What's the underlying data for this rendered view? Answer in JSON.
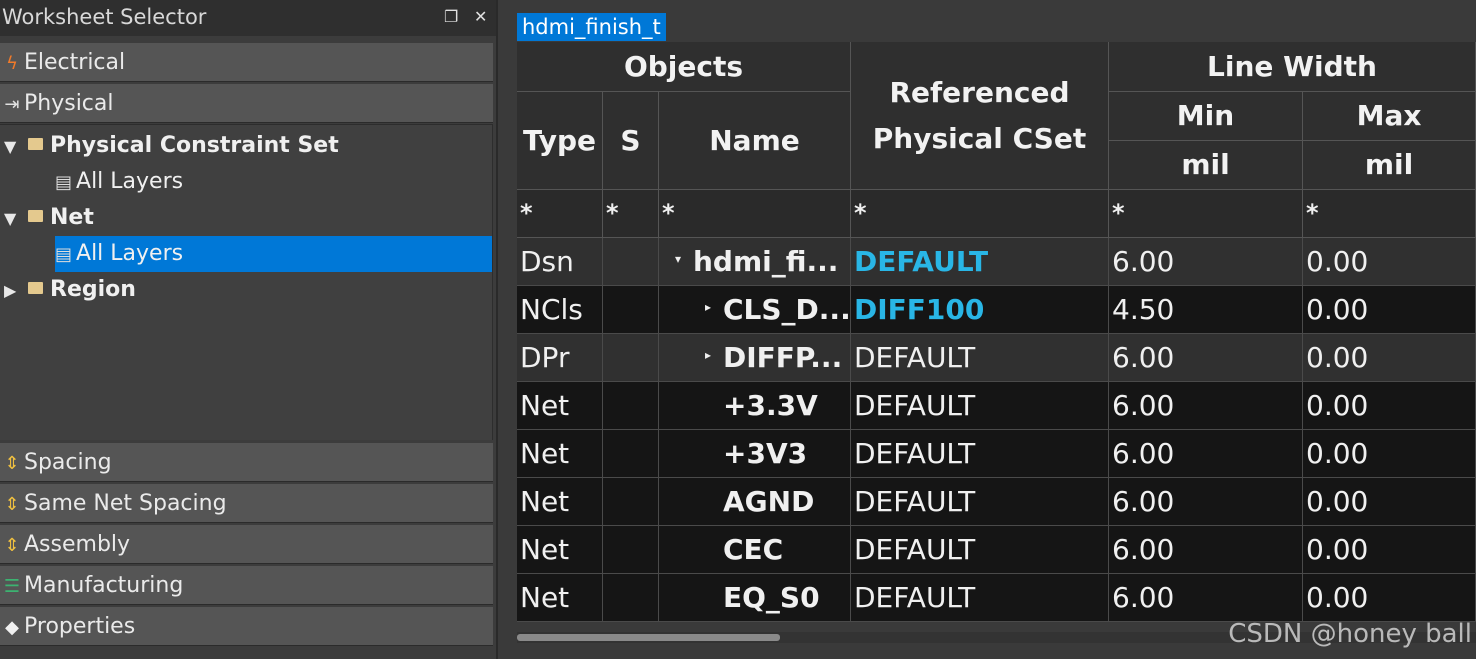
{
  "worksheet_selector": {
    "title": "Worksheet Selector",
    "float_glyph": "❐",
    "close_glyph": "✕",
    "sections_top": [
      {
        "label": "Electrical",
        "icon": "lightning-icon"
      },
      {
        "label": "Physical",
        "icon": "arrows-in-icon"
      }
    ],
    "tree": [
      {
        "label": "Physical Constraint Set",
        "level": 0,
        "expanded": true,
        "type": "folder"
      },
      {
        "label": "All Layers",
        "level": 1,
        "type": "layers"
      },
      {
        "label": "Net",
        "level": 0,
        "expanded": true,
        "type": "folder"
      },
      {
        "label": "All Layers",
        "level": 1,
        "type": "layers",
        "selected": true
      },
      {
        "label": "Region",
        "level": 0,
        "expanded": false,
        "type": "folder"
      }
    ],
    "sections_bottom": [
      {
        "label": "Spacing",
        "icon": "spacing-icon"
      },
      {
        "label": "Same Net Spacing",
        "icon": "spacing-icon"
      },
      {
        "label": "Assembly",
        "icon": "spacing-icon"
      },
      {
        "label": "Manufacturing",
        "icon": "layers-stack-icon"
      },
      {
        "label": "Properties",
        "icon": "tag-icon"
      }
    ]
  },
  "sheet": {
    "tab_label": "hdmi_finish_t",
    "headers": {
      "objects": "Objects",
      "type": "Type",
      "s": "S",
      "name": "Name",
      "referenced_cset": "Referenced Physical CSet",
      "line_width": "Line Width",
      "min": "Min",
      "max": "Max",
      "min_unit": "mil",
      "max_unit": "mil"
    },
    "filters": [
      "*",
      "*",
      "*",
      "*",
      "*",
      "*"
    ],
    "rows": [
      {
        "type": "Dsn",
        "name": "hdmi_fi...",
        "expander": "▾",
        "indent": 0,
        "cset": "DEFAULT",
        "cset_highlight": true,
        "min": "6.00",
        "max": "0.00"
      },
      {
        "type": "NCls",
        "name": "CLS_D...",
        "expander": "▸",
        "indent": 1,
        "cset": "DIFF100",
        "cset_highlight": true,
        "min": "4.50",
        "max": "0.00"
      },
      {
        "type": "DPr",
        "name": "DIFFP...",
        "expander": "▸",
        "indent": 1,
        "cset": "DEFAULT",
        "cset_highlight": false,
        "min": "6.00",
        "max": "0.00"
      },
      {
        "type": "Net",
        "name": "+3.3V",
        "expander": "",
        "indent": 1,
        "cset": "DEFAULT",
        "cset_highlight": false,
        "min": "6.00",
        "max": "0.00"
      },
      {
        "type": "Net",
        "name": "+3V3",
        "expander": "",
        "indent": 1,
        "cset": "DEFAULT",
        "cset_highlight": false,
        "min": "6.00",
        "max": "0.00"
      },
      {
        "type": "Net",
        "name": "AGND",
        "expander": "",
        "indent": 1,
        "cset": "DEFAULT",
        "cset_highlight": false,
        "min": "6.00",
        "max": "0.00"
      },
      {
        "type": "Net",
        "name": "CEC",
        "expander": "",
        "indent": 1,
        "cset": "DEFAULT",
        "cset_highlight": false,
        "min": "6.00",
        "max": "0.00"
      },
      {
        "type": "Net",
        "name": "EQ_S0",
        "expander": "",
        "indent": 1,
        "cset": "DEFAULT",
        "cset_highlight": false,
        "min": "6.00",
        "max": "0.00"
      }
    ]
  },
  "watermark": "CSDN @honey ball",
  "colors": {
    "accent": "#0078d7",
    "cset_highlight": "#29b6e6"
  }
}
